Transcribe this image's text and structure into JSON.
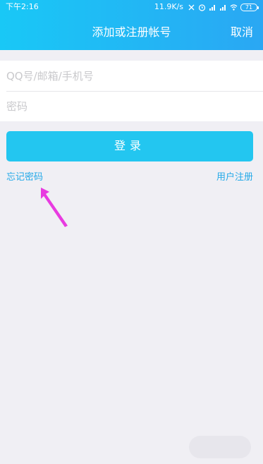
{
  "status_bar": {
    "time": "下午2:16",
    "network_speed": "11.9K/s",
    "battery": "71",
    "icons": [
      "vibrate-off-icon",
      "alarm-icon",
      "signal-hd-icon",
      "signal-icon",
      "wifi-icon",
      "battery-icon"
    ]
  },
  "nav": {
    "title": "添加或注册帐号",
    "cancel_label": "取消"
  },
  "form": {
    "account": {
      "value": "",
      "placeholder": "QQ号/邮箱/手机号"
    },
    "password": {
      "value": "",
      "placeholder": "密码"
    }
  },
  "login_button_label": "登录",
  "links": {
    "forgot_password": "忘记密码",
    "register": "用户注册"
  },
  "colors": {
    "header_start": "#19c8f6",
    "header_end": "#2aa7f3",
    "accent": "#23c6f0",
    "link": "#23a9e8",
    "annotation_arrow": "#e83be0",
    "background": "#f0eff4"
  }
}
